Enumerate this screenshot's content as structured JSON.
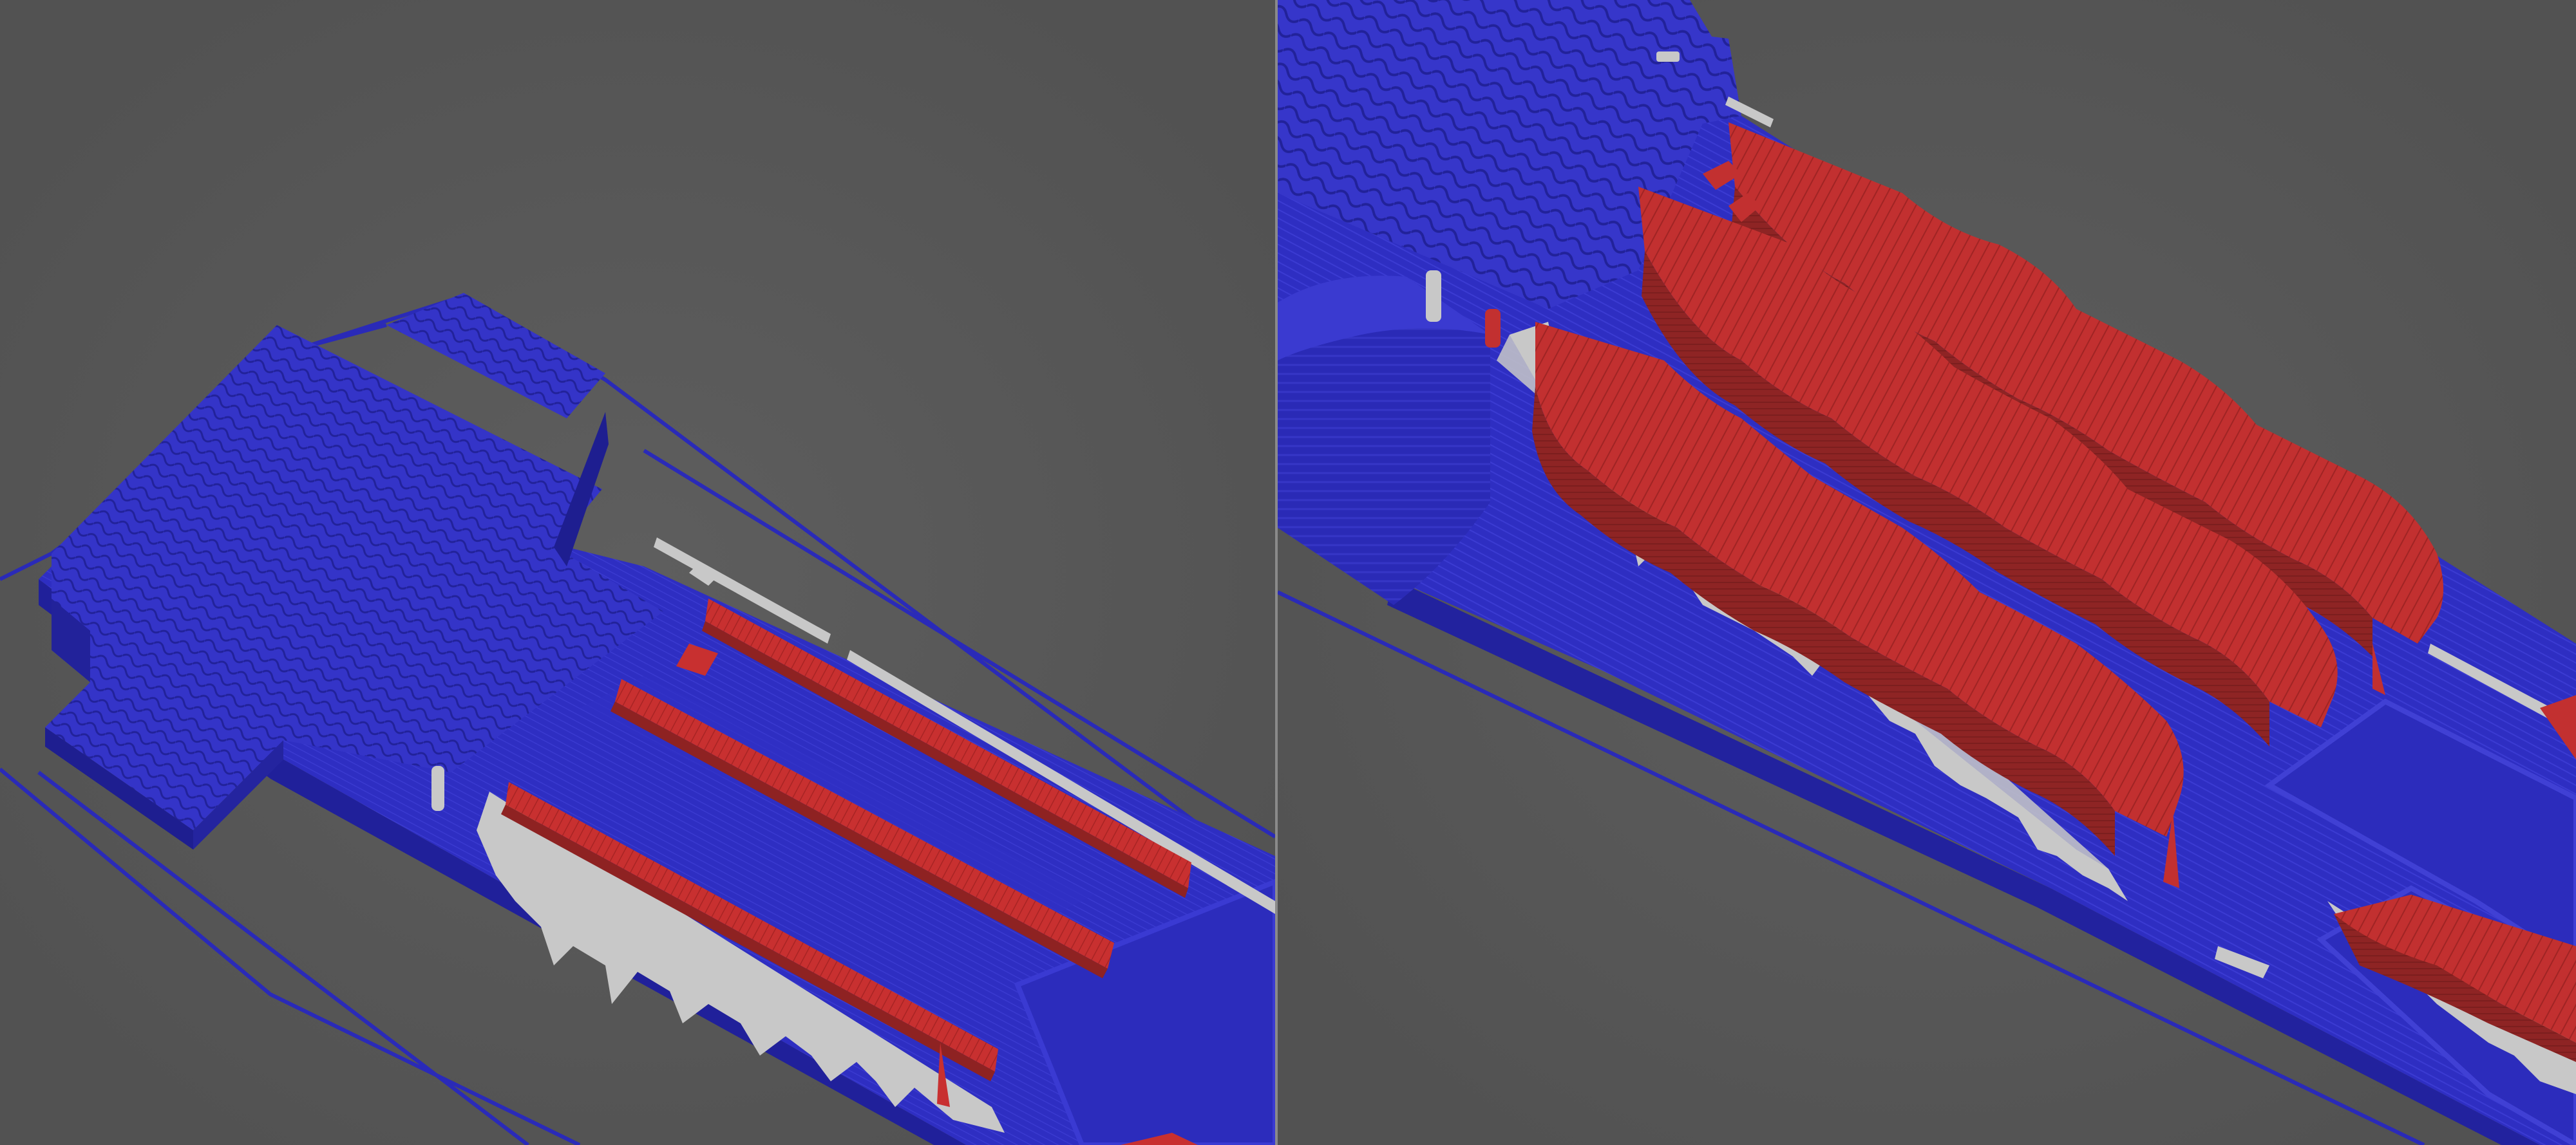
{
  "colors": {
    "background": "#555555",
    "vignette": "#5d5d5d",
    "object_blue": "#2e2ec2",
    "object_blue_light": "#4040d8",
    "object_blue_dark": "#20209a",
    "support_red": "#c83030",
    "support_red_dark": "#8e2222",
    "overhang_gray": "#c8c8c8",
    "travel_blue": "#2a2ab8"
  },
  "views": [
    {
      "name": "left-viewport",
      "content": "sliced-part-wide-view"
    },
    {
      "name": "right-viewport",
      "content": "sliced-part-closeup-view"
    }
  ]
}
